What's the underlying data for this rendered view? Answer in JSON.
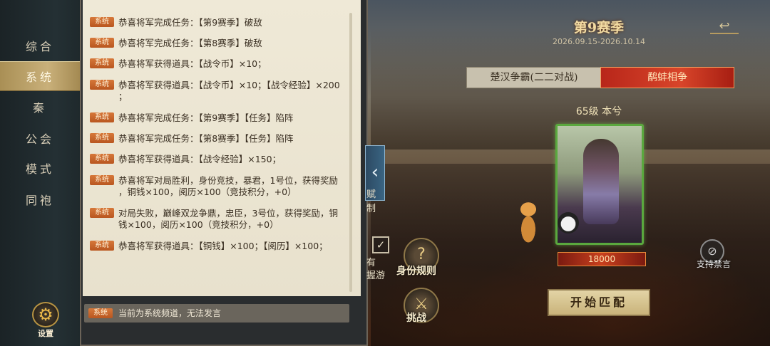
{
  "nav": {
    "items": [
      "综合",
      "系统",
      "秦",
      "公会",
      "模式",
      "同袍"
    ],
    "active_index": 1,
    "settings_label": "设置"
  },
  "chat": {
    "tag": "系统",
    "messages": [
      "恭喜将军完成任务：【第9赛季】破敌",
      "恭喜将军完成任务：【第8赛季】破敌",
      "恭喜将军获得道具：【战令币】×10；",
      "恭喜将军获得道具：【战令币】×10；【战令经验】×200\n；",
      "恭喜将军完成任务：【第9赛季】【任务】陷阵",
      "恭喜将军完成任务：【第8赛季】【任务】陷阵",
      "恭喜将军获得道具：【战令经验】×150；",
      "恭喜将军对局胜利，身份竞技，暴君，1号位，获得奖励\n，铜钱×100，阅历×100（竞技积分，+0）",
      "对局失败，巅峰双龙争鼎，忠臣，3号位，获得奖励，铜\n钱×100，阅历×100（竞技积分，+0）",
      "恭喜将军获得道具：【铜钱】×100；【阅历】×100；"
    ],
    "input_hint": "当前为系统频道，无法发言"
  },
  "middle": {
    "collapse_icon": "chevron-left-icon",
    "checkbox_mark": "✓",
    "text_fragments": [
      "有",
      "握游",
      "赋",
      "制"
    ],
    "rules_label": "身份规则",
    "challenge_label": "挑战"
  },
  "game": {
    "season_title": "第9赛季",
    "season_dates": "2026.09.15-2026.10.14",
    "back_icon": "return-arrow-icon",
    "mode_tabs": [
      "楚汉争霸(二二对战)",
      "鹬蚌相争"
    ],
    "active_mode": 1,
    "hero_level": "65级 本兮",
    "score": "18000",
    "forbid_label": "支持禁言",
    "match_button": "开始匹配"
  }
}
